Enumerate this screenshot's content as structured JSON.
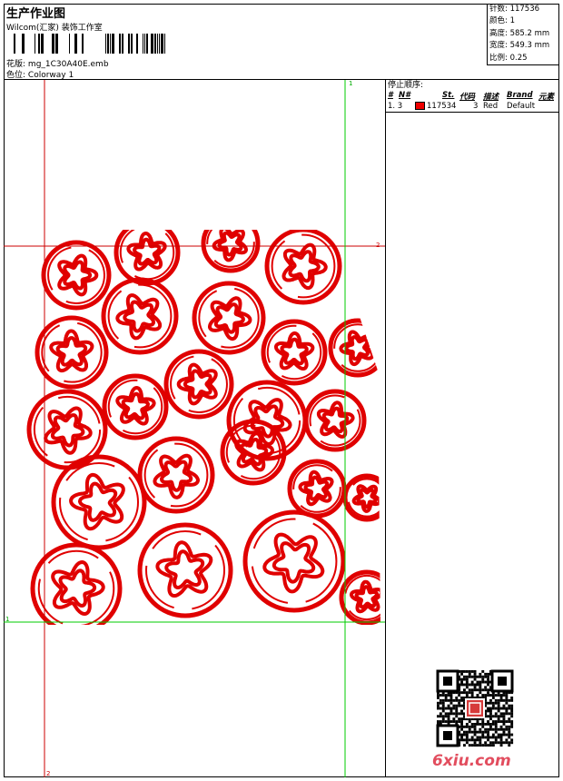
{
  "header": {
    "title": "生产作业图",
    "company": "Wilcom(汇家) 装饰工作室",
    "design_label": "花版:",
    "design_file": "mg_1C30A40E.emb",
    "colorway_label": "色位:",
    "colorway": "Colorway 1"
  },
  "stats": [
    {
      "label": "针数:",
      "value": "117536"
    },
    {
      "label": "颜色:",
      "value": "1"
    },
    {
      "label": "高度:",
      "value": "585.2 mm"
    },
    {
      "label": "宽度:",
      "value": "549.3 mm"
    },
    {
      "label": "比例:",
      "value": "0.25"
    }
  ],
  "sequence": {
    "title": "停止顺序:",
    "columns": {
      "num": "#",
      "no": "N#",
      "stitches": "St.",
      "code": "代码",
      "desc": "描述",
      "brand": "Brand",
      "element": "元素"
    },
    "rows": [
      {
        "num": "1. 3",
        "stitches": "117534",
        "code": "3",
        "desc": "Red",
        "brand": "Default",
        "color": "#e00000"
      }
    ]
  },
  "guides": {
    "g1": "1",
    "g2": "2"
  },
  "watermark": "6xiu.com",
  "colors": {
    "thread": "#e00000",
    "guide_green": "#00cc00",
    "guide_red": "#cc0000"
  }
}
